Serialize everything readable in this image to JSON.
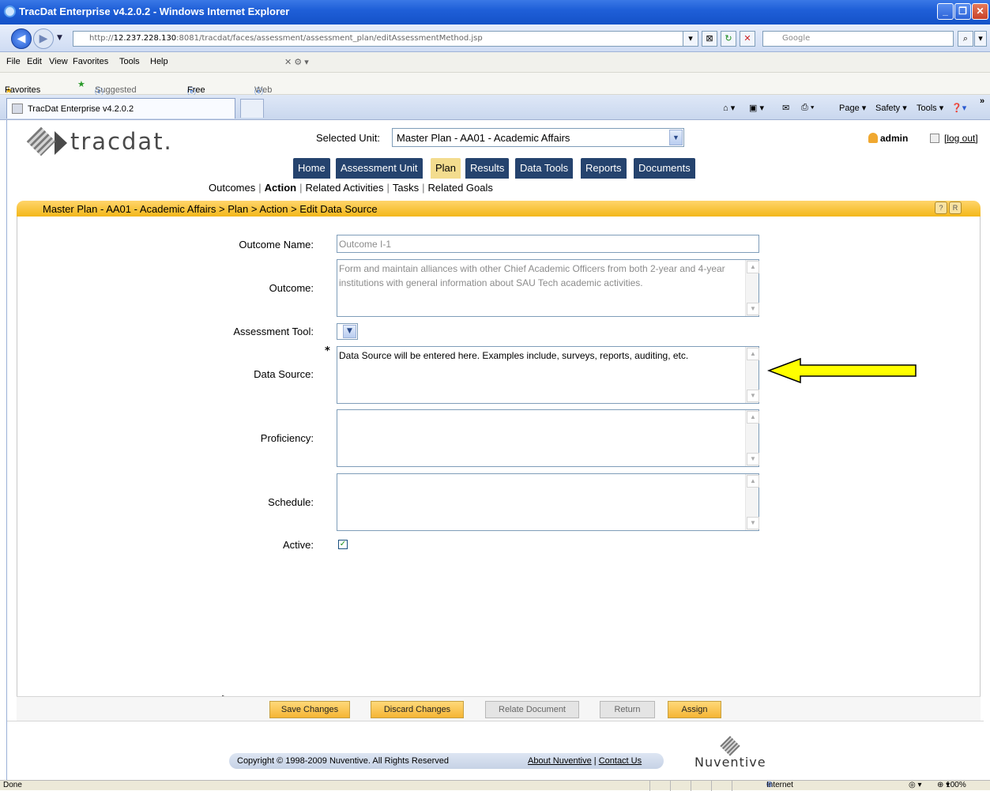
{
  "window": {
    "title": "TracDat Enterprise v4.2.0.2 - Windows Internet Explorer"
  },
  "browser": {
    "url_dim": "http://",
    "url_host": "12.237.228.130",
    "url_path": ":8081/tracdat/faces/assessment/assessment_plan/editAssessmentMethod.jsp",
    "search_placeholder": "Google",
    "menu": [
      "File",
      "Edit",
      "View",
      "Favorites",
      "Tools",
      "Help"
    ],
    "favorites": {
      "favorites_label": "Favorites",
      "suggested": "Suggested Sites ▾",
      "hotmail": "Free Hotmail",
      "webslice": "Web Slice Gallery ▾"
    },
    "tab_title": "TracDat Enterprise v4.2.0.2",
    "commands": {
      "page": "Page ▾",
      "safety": "Safety ▾",
      "tools": "Tools ▾"
    },
    "status": {
      "left": "Done",
      "zone": "Internet",
      "zoom": "100%"
    }
  },
  "app": {
    "logo": "tracdat.",
    "selected_unit_label": "Selected Unit:",
    "selected_unit_value": "Master Plan - AA01 - Academic Affairs",
    "user": "admin",
    "logout": "[log out]",
    "nav_tabs": [
      "Home",
      "Assessment Unit",
      "Plan",
      "Results",
      "Data Tools",
      "Reports",
      "Documents"
    ],
    "active_tab": "Plan",
    "subnav": [
      "Outcomes",
      "Action",
      "Related Activities",
      "Tasks",
      "Related Goals"
    ],
    "breadcrumb": "Master Plan - AA01 - Academic Affairs > Plan > Action > Edit Data Source"
  },
  "form": {
    "outcome_name_label": "Outcome Name:",
    "outcome_name_value": "Outcome I-1",
    "outcome_label": "Outcome:",
    "outcome_value": "Form and maintain alliances with other Chief Academic Officers from both 2-year and 4-year institutions with general information about SAU Tech academic activities.",
    "assessment_tool_label": "Assessment Tool:",
    "required_mark": "*",
    "data_source_label": "Data Source:",
    "data_source_value": "Data Source will be entered here. Examples include, surveys, reports, auditing, etc.",
    "proficiency_label": "Proficiency:",
    "proficiency_value": "",
    "schedule_label": "Schedule:",
    "schedule_value": "",
    "active_label": "Active:",
    "active_checked": true
  },
  "buttons": {
    "save": "Save Changes",
    "discard": "Discard Changes",
    "relate": "Relate Document",
    "return": "Return",
    "assign": "Assign"
  },
  "footer": {
    "copyright": "Copyright © 1998-2009 Nuventive. All Rights Reserved",
    "about": "About Nuventive",
    "contact": "Contact Us",
    "separator": "|",
    "brand": "Nuventive"
  },
  "colors": {
    "nav_tab": "#25436e",
    "active_tab": "#f3dc8e",
    "crumb_bar": "#f3b71a",
    "annotation_arrow": "#ffff00"
  }
}
